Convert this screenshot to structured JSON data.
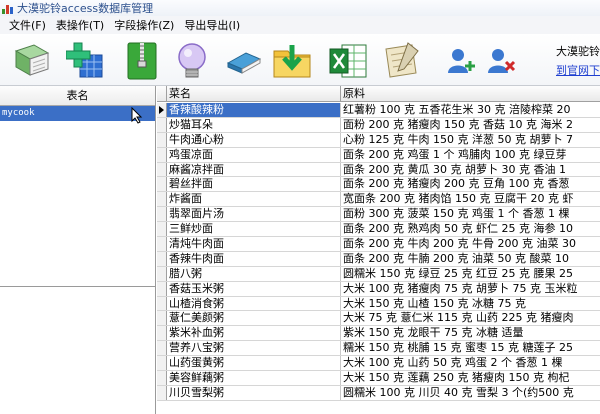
{
  "window": {
    "title": "大漠驼铃access数据库管理"
  },
  "menu": [
    "文件(F)",
    "表操作(T)",
    "字段操作(Z)",
    "导出导出(I)"
  ],
  "toolbar": {
    "buttons": [
      {
        "name": "open-database-icon"
      },
      {
        "name": "add-table-icon"
      },
      {
        "name": "zip-icon"
      },
      {
        "name": "lightbulb-icon"
      },
      {
        "name": "book-icon"
      },
      {
        "name": "import-folder-icon"
      },
      {
        "name": "excel-export-icon"
      },
      {
        "name": "edit-note-icon"
      },
      {
        "name": "add-user-icon"
      },
      {
        "name": "remove-user-icon"
      }
    ],
    "brand": "大漠驼铃",
    "link": "到官网下"
  },
  "tables": {
    "header": "表名",
    "items": [
      "mycook"
    ]
  },
  "grid": {
    "columns": [
      "菜名",
      "原料"
    ],
    "rows": [
      [
        "香辣酸辣粉",
        "红薯粉 100 克 五香花生米 30 克 涪陵榨菜 20"
      ],
      [
        "炒猫耳朵",
        "面粉 200 克 猪瘦肉 150 克 香菇 10 克 海米 2"
      ],
      [
        "牛肉通心粉",
        "心粉 125 克 牛肉 150 克 洋葱 50 克 胡萝卜 7"
      ],
      [
        "鸡蛋凉面",
        "面条 200 克 鸡蛋 1 个 鸡脯肉 100 克 绿豆芽"
      ],
      [
        "麻酱凉拌面",
        "面条 200 克 黄瓜 30 克 胡萝卜 30 克 香油 1"
      ],
      [
        "碧丝拌面",
        "面条 200 克 猪瘦肉 200 克 豆角 100 克 香葱"
      ],
      [
        "炸酱面",
        "宽面条 200 克 猪肉馅 150 克 豆腐干 20 克 虾"
      ],
      [
        "翡翠面片汤",
        "面粉 300 克 菠菜 150 克 鸡蛋 1 个 香葱 1 棵"
      ],
      [
        "三鲜炒面",
        "面条 200 克 熟鸡肉 50 克 虾仁 25 克 海参 10"
      ],
      [
        "清炖牛肉面",
        "面条 200 克 牛肉 200 克 牛骨 200 克 油菜 30"
      ],
      [
        "香辣牛肉面",
        "面条 200 克 牛腩 200 克 油菜 50 克 酸菜 10"
      ],
      [
        "腊八粥",
        "圆糯米 150 克 绿豆 25 克 红豆 25 克 腰果 25"
      ],
      [
        "香菇玉米粥",
        "大米 100 克 猪瘦肉 75 克 胡萝卜 75 克 玉米粒"
      ],
      [
        "山楂消食粥",
        "大米 150 克 山楂 150 克 冰糖 75 克"
      ],
      [
        "薏仁美颜粥",
        "大米 75 克 薏仁米 115 克 山药 225 克 猪瘦肉"
      ],
      [
        "紫米补血粥",
        "紫米 150 克 龙眼干 75 克 冰糖 适量"
      ],
      [
        "营养八宝粥",
        "糯米 150 克 桃脯 15 克 蜜枣 15 克 糖莲子 25"
      ],
      [
        "山药蛋黄粥",
        "大米 100 克 山药 50 克 鸡蛋 2 个 香葱 1 棵"
      ],
      [
        "美容鲜藕粥",
        "大米 150 克 莲藕 250 克 猪瘦肉 150 克 枸杞"
      ],
      [
        "川贝雪梨粥",
        "圆糯米 100 克 川贝 40 克 雪梨 3 个(约500 克"
      ]
    ]
  }
}
